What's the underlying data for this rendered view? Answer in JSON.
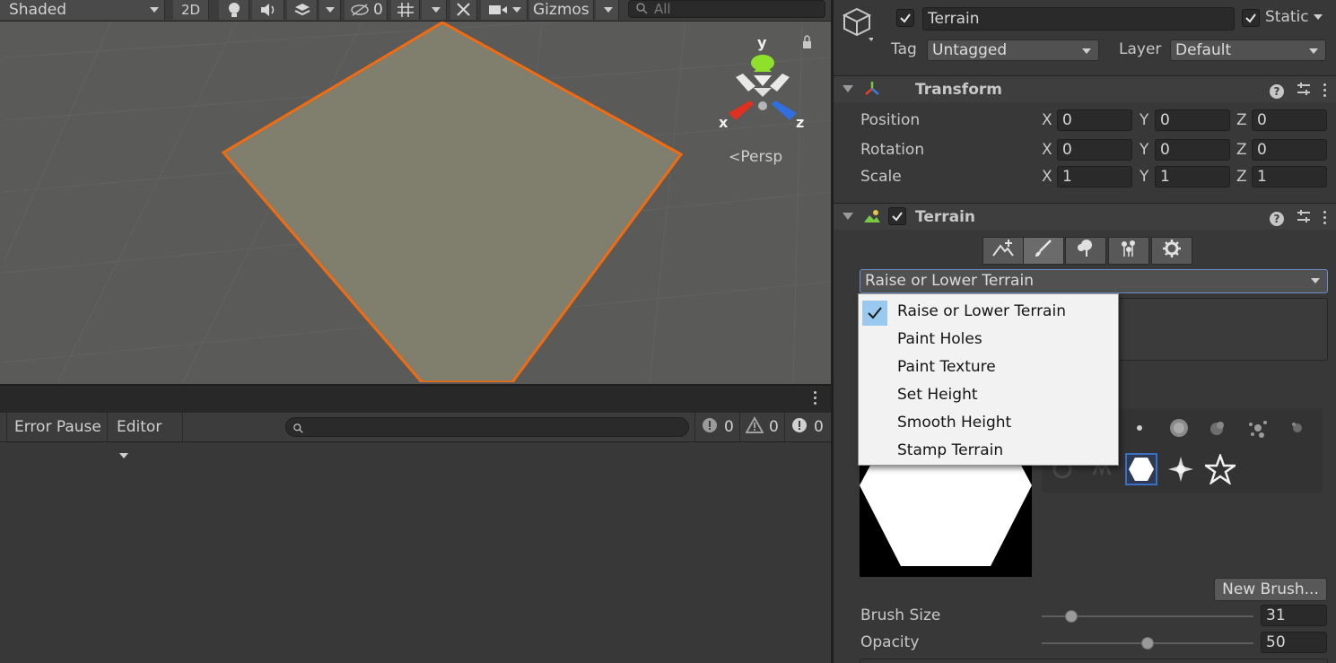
{
  "scene": {
    "shading_mode": "Shaded",
    "mode_2d": "2D",
    "hidden_count": "0",
    "gizmos_label": "Gizmos",
    "search_placeholder": "All",
    "persp_label": "Persp",
    "axis_labels": {
      "x": "x",
      "y": "y",
      "z": "z"
    },
    "colors": {
      "selection_outline": "#f26b10",
      "terrain_fill": "#807e6c",
      "grid_background": "#5a5a58"
    }
  },
  "console": {
    "error_pause_label": "Error Pause",
    "editor_label": "Editor",
    "log_count": "0",
    "warning_count": "0",
    "error_count": "0"
  },
  "inspector": {
    "object_name": "Terrain",
    "static_label": "Static",
    "tag_label": "Tag",
    "tag_value": "Untagged",
    "layer_label": "Layer",
    "layer_value": "Default",
    "transform": {
      "title": "Transform",
      "rows": [
        {
          "label": "Position",
          "x": "0",
          "y": "0",
          "z": "0"
        },
        {
          "label": "Rotation",
          "x": "0",
          "y": "0",
          "z": "0"
        },
        {
          "label": "Scale",
          "x": "1",
          "y": "1",
          "z": "1"
        }
      ],
      "axis": {
        "x": "X",
        "y": "Y",
        "z": "Z"
      }
    },
    "terrain_component": {
      "title": "Terrain",
      "tool_selected": "Raise or Lower Terrain",
      "new_brush_label": "New Brush...",
      "brush_size_label": "Brush Size",
      "brush_size_value": "31",
      "brush_size_fraction": 0.14,
      "opacity_label": "Opacity",
      "opacity_value": "50",
      "opacity_fraction": 0.5
    }
  },
  "dropdown": {
    "items": [
      {
        "label": "Raise or Lower Terrain",
        "checked": true
      },
      {
        "label": "Paint Holes",
        "checked": false
      },
      {
        "label": "Paint Texture",
        "checked": false
      },
      {
        "label": "Set Height",
        "checked": false
      },
      {
        "label": "Smooth Height",
        "checked": false
      },
      {
        "label": "Stamp Terrain",
        "checked": false
      }
    ]
  }
}
